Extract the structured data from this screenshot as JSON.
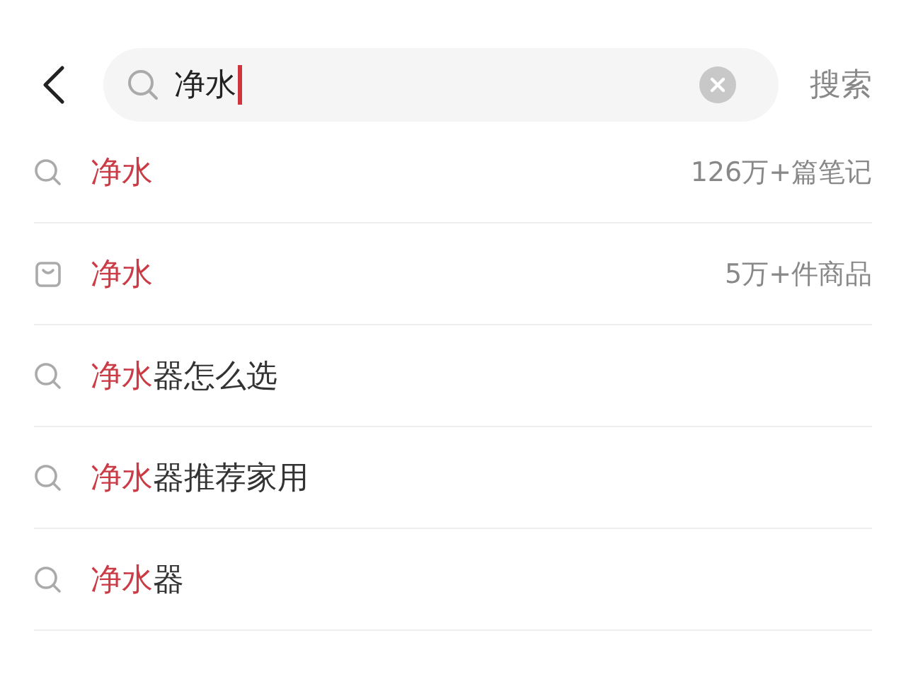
{
  "search": {
    "value": "净水",
    "action": "搜索"
  },
  "suggestions": [
    {
      "kind": "search",
      "match": "净水",
      "count": "126万+篇笔记"
    },
    {
      "kind": "product",
      "match": "净水",
      "count": "5万+件商品"
    },
    {
      "kind": "search",
      "match": "净水",
      "rest": "器怎么选"
    },
    {
      "kind": "search",
      "match": "净水",
      "rest": "器推荐家用"
    },
    {
      "kind": "search",
      "match": "净水",
      "rest": "器"
    }
  ]
}
